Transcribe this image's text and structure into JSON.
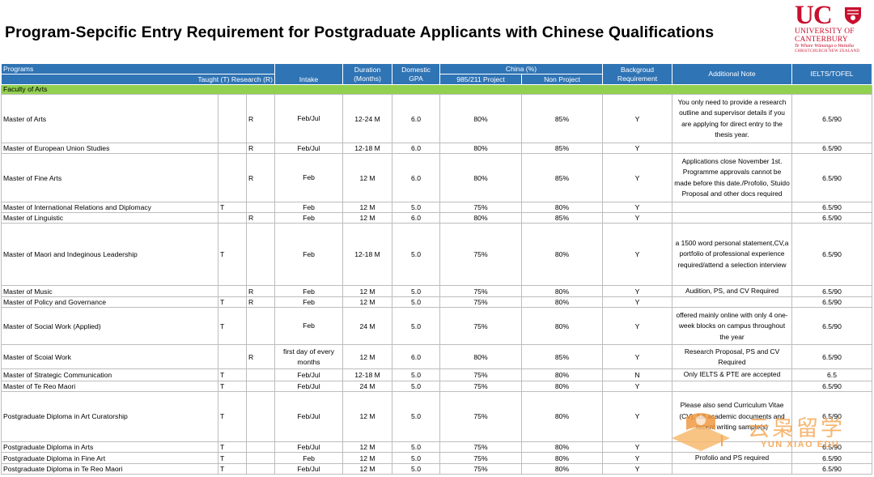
{
  "title": "Program-Sepcific Entry Requirement for Postgraduate Applicants with Chinese Qualifications",
  "logo": {
    "letters": "UC",
    "line1": "UNIVERSITY OF",
    "line2": "CANTERBURY",
    "line3": "Te Whare Wānanga o Waitaha",
    "line4": "CHRISTCHURCH NEW ZEALAND"
  },
  "header": {
    "programs": "Programs",
    "type": "Taught (T) Research (R)",
    "intake": "Intake",
    "duration": "Duration (Months)",
    "domestic": "Domestic GPA",
    "china": "China (%)",
    "p985": "985/211 Project",
    "nonproject": "Non Project",
    "background": "Backgroud Requirement",
    "note": "Additional Note",
    "ielts": "IELTS/TOFEL"
  },
  "faculty": "Faculty of Arts",
  "rows": [
    {
      "program": "Master of Arts",
      "t": "",
      "r": "R",
      "intake": "Feb/Jul",
      "duration": "12-24 M",
      "gpa": "6.0",
      "p985": "80%",
      "non": "85%",
      "bg": "Y",
      "note": "You only need to provide a research outline and supervisor details if you are applying for direct entry to the thesis year.",
      "ielts": "6.5/90"
    },
    {
      "program": "Master of European Union Studies",
      "t": "",
      "r": "R",
      "intake": "Feb/Jul",
      "duration": "12-18 M",
      "gpa": "6.0",
      "p985": "80%",
      "non": "85%",
      "bg": "Y",
      "note": "",
      "ielts": "6.5/90"
    },
    {
      "program": "Master of Fine Arts",
      "t": "",
      "r": "R",
      "intake": "Feb",
      "duration": "12 M",
      "gpa": "6.0",
      "p985": "80%",
      "non": "85%",
      "bg": "Y",
      "note": "Applications close November 1st. Programme approvals cannot be made before this date./Profolio, Stuido Proposal and other docs required",
      "ielts": "6.5/90"
    },
    {
      "program": "Master of International Relations and Diplomacy",
      "t": "T",
      "r": "",
      "intake": "Feb",
      "duration": "12 M",
      "gpa": "5.0",
      "p985": "75%",
      "non": "80%",
      "bg": "Y",
      "note": "",
      "ielts": "6.5/90"
    },
    {
      "program": "Master of Linguistic",
      "t": "",
      "r": "R",
      "intake": "Feb",
      "duration": "12 M",
      "gpa": "6.0",
      "p985": "80%",
      "non": "85%",
      "bg": "Y",
      "note": "",
      "ielts": "6.5/90"
    },
    {
      "program": "Master of Maori and Indeginous Leadership",
      "t": "T",
      "r": "",
      "intake": "Feb",
      "duration": "12-18 M",
      "gpa": "5.0",
      "p985": "75%",
      "non": "80%",
      "bg": "Y",
      "note": "a 1500 word personal statement,CV,a portfolio of professional experience required/attend a selection interview",
      "ielts": "6.5/90"
    },
    {
      "program": "Master of Music",
      "t": "",
      "r": "R",
      "intake": "Feb",
      "duration": "12 M",
      "gpa": "5.0",
      "p985": "75%",
      "non": "80%",
      "bg": "Y",
      "note": "Audition, PS, and CV Required",
      "ielts": "6.5/90"
    },
    {
      "program": "Master of Policy and Governance",
      "t": "T",
      "r": "R",
      "intake": "Feb",
      "duration": "12 M",
      "gpa": "5.0",
      "p985": "75%",
      "non": "80%",
      "bg": "Y",
      "note": "",
      "ielts": "6.5/90"
    },
    {
      "program": "Master of Social Work (Applied)",
      "t": "T",
      "r": "",
      "intake": "Feb",
      "duration": "24 M",
      "gpa": "5.0",
      "p985": "75%",
      "non": "80%",
      "bg": "Y",
      "note": "offered mainly online with only 4 one-week blocks on campus throughout the year",
      "ielts": "6.5/90"
    },
    {
      "program": "Master of Scoial Work",
      "t": "",
      "r": "R",
      "intake": "first day of every months",
      "duration": "12 M",
      "gpa": "6.0",
      "p985": "80%",
      "non": "85%",
      "bg": "Y",
      "note": "Research Proposal, PS and CV Required",
      "ielts": "6.5/90"
    },
    {
      "program": "Master of Strategic Communication",
      "t": "T",
      "r": "",
      "intake": "Feb/Jul",
      "duration": "12-18 M",
      "gpa": "5.0",
      "p985": "75%",
      "non": "80%",
      "bg": "N",
      "note": "Only IELTS & PTE are accepted",
      "ielts": "6.5"
    },
    {
      "program": "Master of Te Reo Maori",
      "t": "T",
      "r": "",
      "intake": "Feb/Jul",
      "duration": "24 M",
      "gpa": "5.0",
      "p985": "75%",
      "non": "80%",
      "bg": "Y",
      "note": "",
      "ielts": "6.5/90"
    },
    {
      "program": "Postgraduate Diploma in Art Curatorship",
      "t": "T",
      "r": "",
      "intake": "Feb/Jul",
      "duration": "12 M",
      "gpa": "5.0",
      "p985": "75%",
      "non": "80%",
      "bg": "Y",
      "note": "Please also send Curriculum Vitae (CV), full academic documents and recent writing sample(s)",
      "ielts": "6.5/90"
    },
    {
      "program": "Postgraduate Diploma in Arts",
      "t": "T",
      "r": "",
      "intake": "Feb/Jul",
      "duration": "12 M",
      "gpa": "5.0",
      "p985": "75%",
      "non": "80%",
      "bg": "Y",
      "note": "",
      "ielts": "6.5/90"
    },
    {
      "program": "Postgraduate Diploma in Fine Art",
      "t": "T",
      "r": "",
      "intake": "Feb",
      "duration": "12 M",
      "gpa": "5.0",
      "p985": "75%",
      "non": "80%",
      "bg": "Y",
      "note": "Profolio and PS required",
      "ielts": "6.5/90"
    },
    {
      "program": "Postgraduate Diploma in Te Reo Maori",
      "t": "T",
      "r": "",
      "intake": "Feb/Jul",
      "duration": "12 M",
      "gpa": "5.0",
      "p985": "75%",
      "non": "80%",
      "bg": "Y",
      "note": "",
      "ielts": "6.5/90"
    }
  ],
  "watermark": {
    "cn": "云枭留学",
    "en": "YUN XIAO EDU"
  }
}
